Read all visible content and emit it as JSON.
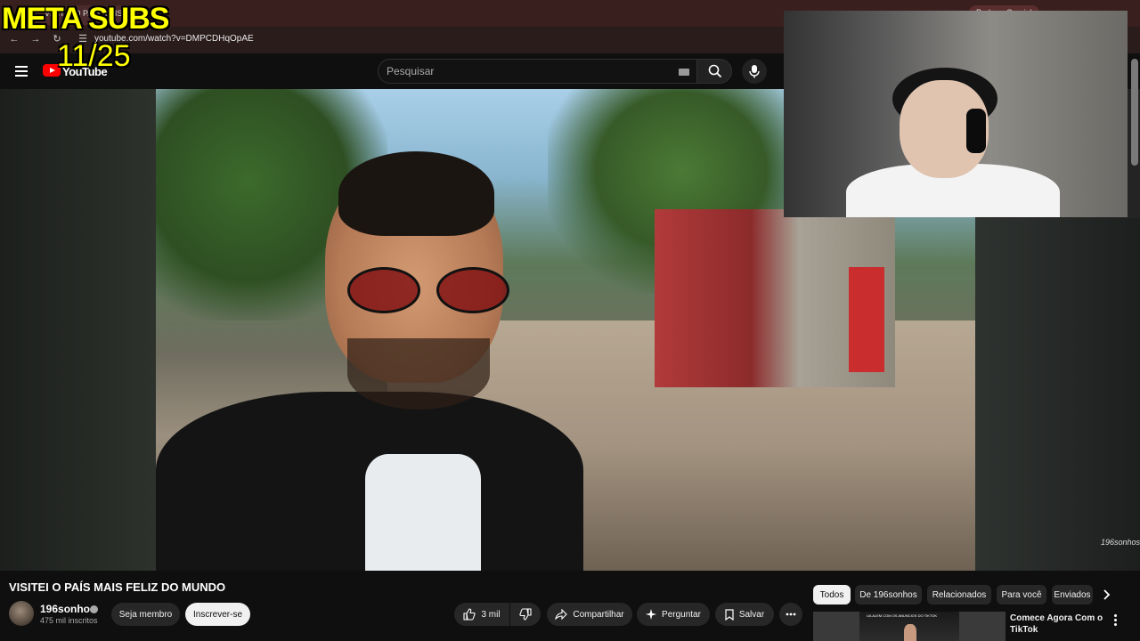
{
  "browser": {
    "tab_title": "VISITEI O PAÍS MAIS...",
    "profile_label": "Pedro e Gamial",
    "url": "youtube.com/watch?v=DMPCDHqOpAE"
  },
  "overlay": {
    "title": "META SUBS",
    "counter": "11/25"
  },
  "header": {
    "logo_text": "YouTube",
    "search_placeholder": "Pesquisar"
  },
  "video": {
    "watermark": "196sonhos",
    "title": "VISITEI O PAÍS MAIS FELIZ DO MUNDO"
  },
  "channel": {
    "name": "196sonhos",
    "subscribers": "475 mil inscritos",
    "member_label": "Seja membro",
    "subscribe_label": "Inscrever-se"
  },
  "actions": {
    "likes": "3 mil",
    "share": "Compartilhar",
    "ask": "Perguntar",
    "save": "Salvar"
  },
  "sidebar": {
    "chips": [
      "Todos",
      "De 196sonhos",
      "Relacionados",
      "Para você",
      "Enviados"
    ],
    "recommendation": {
      "thumbnail_text": "UA ALEM COM OS ANUNCIOS DO TIKTOK",
      "title": "Comece Agora Com o TikTok"
    }
  },
  "colors": {
    "subscribe_bg": "#f1f1f1",
    "overlay_text": "#ffff00",
    "brand_red": "#ff0000"
  }
}
